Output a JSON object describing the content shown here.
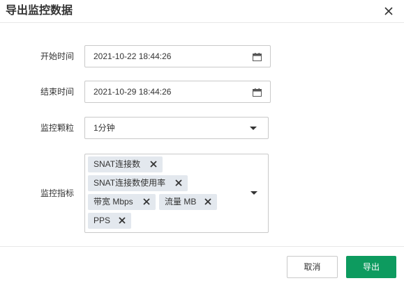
{
  "dialog": {
    "title": "导出监控数据"
  },
  "form": {
    "start_time": {
      "label": "开始时间",
      "value": "2021-10-22 18:44:26"
    },
    "end_time": {
      "label": "结束时间",
      "value": "2021-10-29 18:44:26"
    },
    "granularity": {
      "label": "监控颗粒",
      "value": "1分钟"
    },
    "metrics": {
      "label": "监控指标",
      "tags": [
        "SNAT连接数",
        "SNAT连接数使用率",
        "带宽 Mbps",
        "流量 MB",
        "PPS"
      ]
    }
  },
  "footer": {
    "cancel_label": "取消",
    "export_label": "导出"
  },
  "colors": {
    "primary": "#0d9b5f",
    "tag_bg": "#e3e8ee",
    "border": "#c9c9c9"
  },
  "icons": [
    "close-icon",
    "calendar-icon",
    "chevron-down-icon",
    "remove-tag-icon"
  ]
}
